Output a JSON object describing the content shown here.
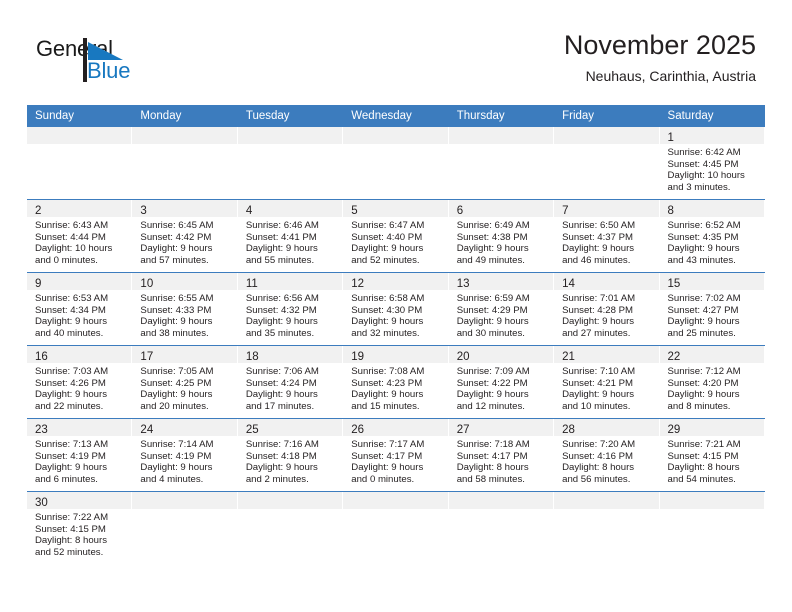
{
  "brand": {
    "name_part1": "General",
    "name_part2": "Blue"
  },
  "header": {
    "title": "November 2025",
    "subtitle": "Neuhaus, Carinthia, Austria"
  },
  "colors": {
    "header_blue": "#3c7cbe",
    "brand_blue": "#1878c0",
    "daynum_band": "#f1f1f1",
    "text": "#231f20"
  },
  "weekday_headers": [
    "Sunday",
    "Monday",
    "Tuesday",
    "Wednesday",
    "Thursday",
    "Friday",
    "Saturday"
  ],
  "weeks": [
    [
      {
        "day": "",
        "lines": []
      },
      {
        "day": "",
        "lines": []
      },
      {
        "day": "",
        "lines": []
      },
      {
        "day": "",
        "lines": []
      },
      {
        "day": "",
        "lines": []
      },
      {
        "day": "",
        "lines": []
      },
      {
        "day": "1",
        "lines": [
          "Sunrise: 6:42 AM",
          "Sunset: 4:45 PM",
          "Daylight: 10 hours",
          "and 3 minutes."
        ]
      }
    ],
    [
      {
        "day": "2",
        "lines": [
          "Sunrise: 6:43 AM",
          "Sunset: 4:44 PM",
          "Daylight: 10 hours",
          "and 0 minutes."
        ]
      },
      {
        "day": "3",
        "lines": [
          "Sunrise: 6:45 AM",
          "Sunset: 4:42 PM",
          "Daylight: 9 hours",
          "and 57 minutes."
        ]
      },
      {
        "day": "4",
        "lines": [
          "Sunrise: 6:46 AM",
          "Sunset: 4:41 PM",
          "Daylight: 9 hours",
          "and 55 minutes."
        ]
      },
      {
        "day": "5",
        "lines": [
          "Sunrise: 6:47 AM",
          "Sunset: 4:40 PM",
          "Daylight: 9 hours",
          "and 52 minutes."
        ]
      },
      {
        "day": "6",
        "lines": [
          "Sunrise: 6:49 AM",
          "Sunset: 4:38 PM",
          "Daylight: 9 hours",
          "and 49 minutes."
        ]
      },
      {
        "day": "7",
        "lines": [
          "Sunrise: 6:50 AM",
          "Sunset: 4:37 PM",
          "Daylight: 9 hours",
          "and 46 minutes."
        ]
      },
      {
        "day": "8",
        "lines": [
          "Sunrise: 6:52 AM",
          "Sunset: 4:35 PM",
          "Daylight: 9 hours",
          "and 43 minutes."
        ]
      }
    ],
    [
      {
        "day": "9",
        "lines": [
          "Sunrise: 6:53 AM",
          "Sunset: 4:34 PM",
          "Daylight: 9 hours",
          "and 40 minutes."
        ]
      },
      {
        "day": "10",
        "lines": [
          "Sunrise: 6:55 AM",
          "Sunset: 4:33 PM",
          "Daylight: 9 hours",
          "and 38 minutes."
        ]
      },
      {
        "day": "11",
        "lines": [
          "Sunrise: 6:56 AM",
          "Sunset: 4:32 PM",
          "Daylight: 9 hours",
          "and 35 minutes."
        ]
      },
      {
        "day": "12",
        "lines": [
          "Sunrise: 6:58 AM",
          "Sunset: 4:30 PM",
          "Daylight: 9 hours",
          "and 32 minutes."
        ]
      },
      {
        "day": "13",
        "lines": [
          "Sunrise: 6:59 AM",
          "Sunset: 4:29 PM",
          "Daylight: 9 hours",
          "and 30 minutes."
        ]
      },
      {
        "day": "14",
        "lines": [
          "Sunrise: 7:01 AM",
          "Sunset: 4:28 PM",
          "Daylight: 9 hours",
          "and 27 minutes."
        ]
      },
      {
        "day": "15",
        "lines": [
          "Sunrise: 7:02 AM",
          "Sunset: 4:27 PM",
          "Daylight: 9 hours",
          "and 25 minutes."
        ]
      }
    ],
    [
      {
        "day": "16",
        "lines": [
          "Sunrise: 7:03 AM",
          "Sunset: 4:26 PM",
          "Daylight: 9 hours",
          "and 22 minutes."
        ]
      },
      {
        "day": "17",
        "lines": [
          "Sunrise: 7:05 AM",
          "Sunset: 4:25 PM",
          "Daylight: 9 hours",
          "and 20 minutes."
        ]
      },
      {
        "day": "18",
        "lines": [
          "Sunrise: 7:06 AM",
          "Sunset: 4:24 PM",
          "Daylight: 9 hours",
          "and 17 minutes."
        ]
      },
      {
        "day": "19",
        "lines": [
          "Sunrise: 7:08 AM",
          "Sunset: 4:23 PM",
          "Daylight: 9 hours",
          "and 15 minutes."
        ]
      },
      {
        "day": "20",
        "lines": [
          "Sunrise: 7:09 AM",
          "Sunset: 4:22 PM",
          "Daylight: 9 hours",
          "and 12 minutes."
        ]
      },
      {
        "day": "21",
        "lines": [
          "Sunrise: 7:10 AM",
          "Sunset: 4:21 PM",
          "Daylight: 9 hours",
          "and 10 minutes."
        ]
      },
      {
        "day": "22",
        "lines": [
          "Sunrise: 7:12 AM",
          "Sunset: 4:20 PM",
          "Daylight: 9 hours",
          "and 8 minutes."
        ]
      }
    ],
    [
      {
        "day": "23",
        "lines": [
          "Sunrise: 7:13 AM",
          "Sunset: 4:19 PM",
          "Daylight: 9 hours",
          "and 6 minutes."
        ]
      },
      {
        "day": "24",
        "lines": [
          "Sunrise: 7:14 AM",
          "Sunset: 4:19 PM",
          "Daylight: 9 hours",
          "and 4 minutes."
        ]
      },
      {
        "day": "25",
        "lines": [
          "Sunrise: 7:16 AM",
          "Sunset: 4:18 PM",
          "Daylight: 9 hours",
          "and 2 minutes."
        ]
      },
      {
        "day": "26",
        "lines": [
          "Sunrise: 7:17 AM",
          "Sunset: 4:17 PM",
          "Daylight: 9 hours",
          "and 0 minutes."
        ]
      },
      {
        "day": "27",
        "lines": [
          "Sunrise: 7:18 AM",
          "Sunset: 4:17 PM",
          "Daylight: 8 hours",
          "and 58 minutes."
        ]
      },
      {
        "day": "28",
        "lines": [
          "Sunrise: 7:20 AM",
          "Sunset: 4:16 PM",
          "Daylight: 8 hours",
          "and 56 minutes."
        ]
      },
      {
        "day": "29",
        "lines": [
          "Sunrise: 7:21 AM",
          "Sunset: 4:15 PM",
          "Daylight: 8 hours",
          "and 54 minutes."
        ]
      }
    ],
    [
      {
        "day": "30",
        "lines": [
          "Sunrise: 7:22 AM",
          "Sunset: 4:15 PM",
          "Daylight: 8 hours",
          "and 52 minutes."
        ]
      },
      {
        "day": "",
        "lines": []
      },
      {
        "day": "",
        "lines": []
      },
      {
        "day": "",
        "lines": []
      },
      {
        "day": "",
        "lines": []
      },
      {
        "day": "",
        "lines": []
      },
      {
        "day": "",
        "lines": []
      }
    ]
  ]
}
